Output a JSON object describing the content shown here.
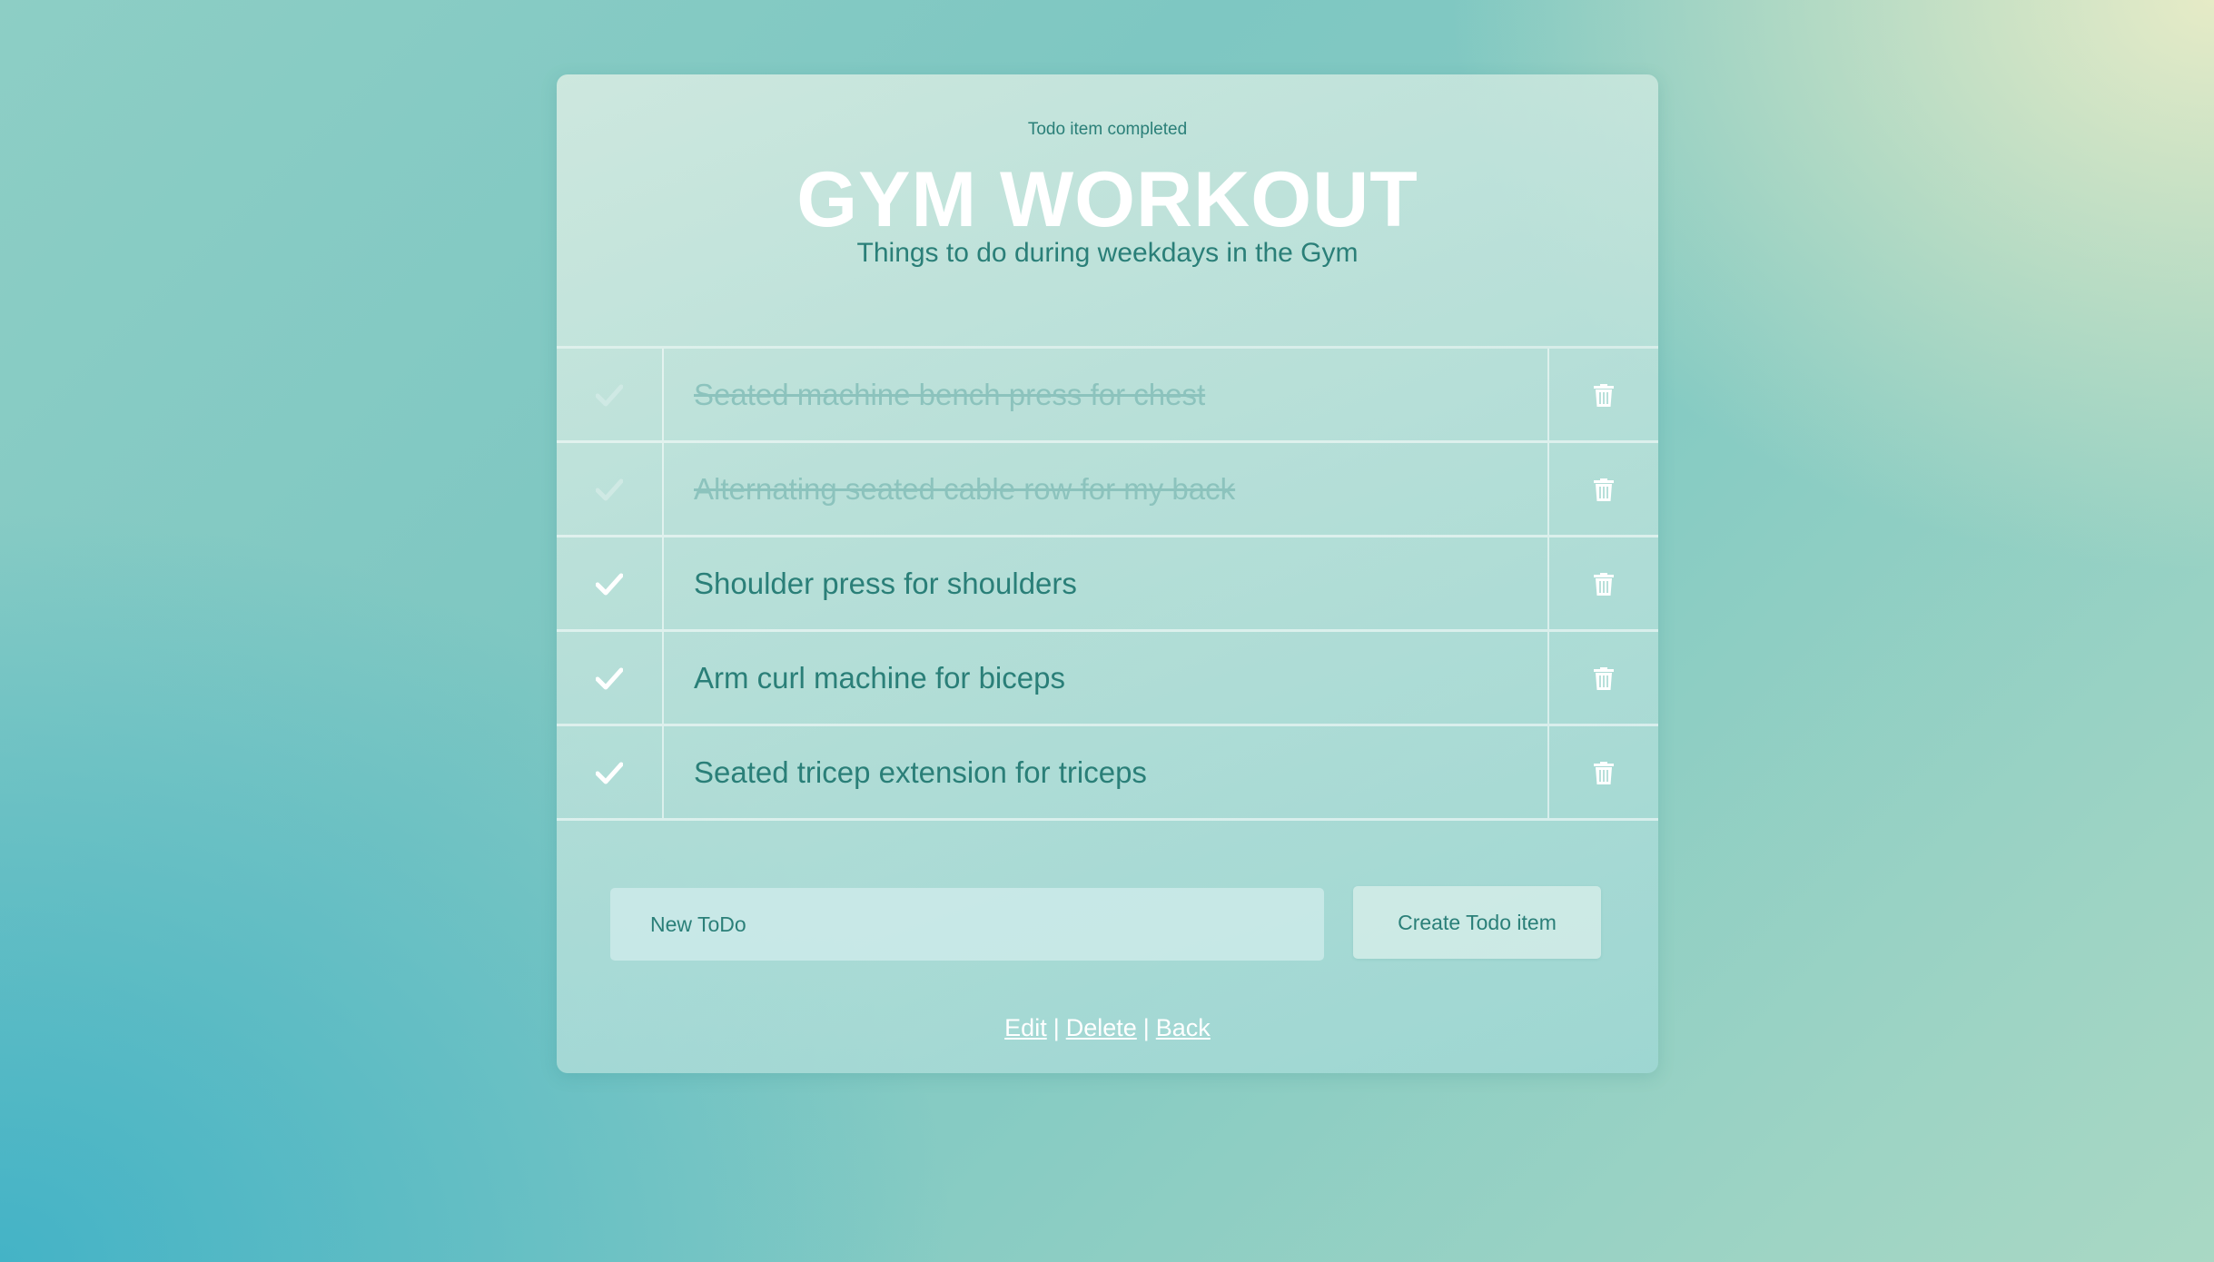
{
  "header": {
    "status": "Todo item completed",
    "title": "GYM WORKOUT",
    "subtitle": "Things to do during weekdays in the Gym"
  },
  "todos": [
    {
      "text": "Seated machine bench press for chest",
      "completed": true
    },
    {
      "text": "Alternating seated cable row for my back",
      "completed": true
    },
    {
      "text": "Shoulder press for shoulders",
      "completed": false
    },
    {
      "text": "Arm curl machine for biceps",
      "completed": false
    },
    {
      "text": "Seated tricep extension for triceps",
      "completed": false
    }
  ],
  "icons": {
    "check": "check-icon",
    "delete": "trash-icon"
  },
  "form": {
    "placeholder": "New ToDo",
    "value": "",
    "button_label": "Create Todo item"
  },
  "footer": {
    "edit": "Edit",
    "delete": "Delete",
    "back": "Back",
    "separator": "|"
  },
  "colors": {
    "accent_text": "#2a7f78",
    "completed_text": "#8cc3bd",
    "completed_check": "#cfe9e4",
    "active_check": "#ffffff"
  }
}
